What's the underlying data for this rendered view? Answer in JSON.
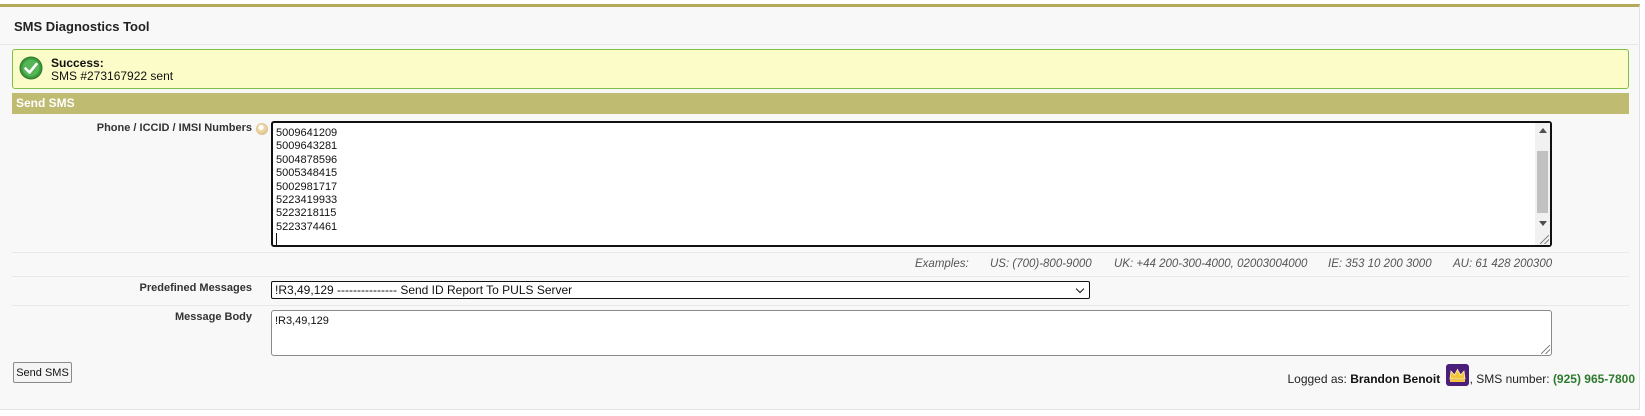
{
  "app": {
    "title": "SMS Diagnostics Tool"
  },
  "alert": {
    "title": "Success:",
    "message": "SMS #273167922 sent",
    "icon": "check-circle-icon",
    "accent": "#7fbf47"
  },
  "section": {
    "title": "Send SMS",
    "color": "#bfbb71"
  },
  "form": {
    "numbers_label": "Phone / ICCID / IMSI Numbers",
    "numbers": [
      "5009641209",
      "5009643281",
      "5004878596",
      "5005348415",
      "5002981717",
      "5223419933",
      "5223218115",
      "5223374461"
    ],
    "examples": {
      "label": "Examples:",
      "us": "US: (700)-800-9000",
      "uk": "UK: +44 200-300-4000, 02003004000",
      "ie": "IE: 353 10 200 3000",
      "au": "AU: 61 428 200300"
    },
    "predefined_label": "Predefined Messages",
    "predefined_selected": "!R3,49,129 --------------- Send ID Report To PULS Server",
    "body_label": "Message Body",
    "body_value": "!R3,49,129",
    "send_button": "Send SMS"
  },
  "footer": {
    "logged_as_label": "Logged as:",
    "user_name": "Brandon Benoit",
    "sms_number_label": ", SMS number:",
    "sms_number": "(925) 965-7800",
    "badge_icon": "crown-icon"
  }
}
